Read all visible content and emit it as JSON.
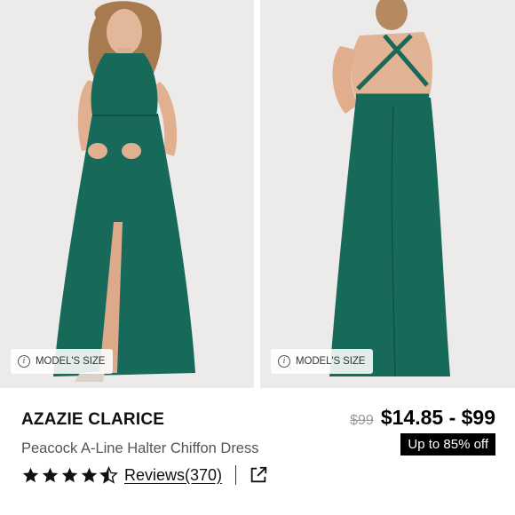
{
  "gallery": {
    "model_size_label_1": "MODEL'S SIZE",
    "model_size_label_2": "MODEL'S SIZE",
    "dress_color": "#17695a"
  },
  "product": {
    "brand": "AZAZIE CLARICE",
    "name": "Peacock A-Line Halter Chiffon Dress",
    "original_price": "$99",
    "price_range": "$14.85 - $99",
    "discount": "Up to 85% off"
  },
  "rating": {
    "stars": 4.5,
    "reviews_label": "Reviews(370)"
  },
  "icons": {
    "info": "info-icon",
    "star": "star-icon",
    "share": "external-link-icon"
  }
}
